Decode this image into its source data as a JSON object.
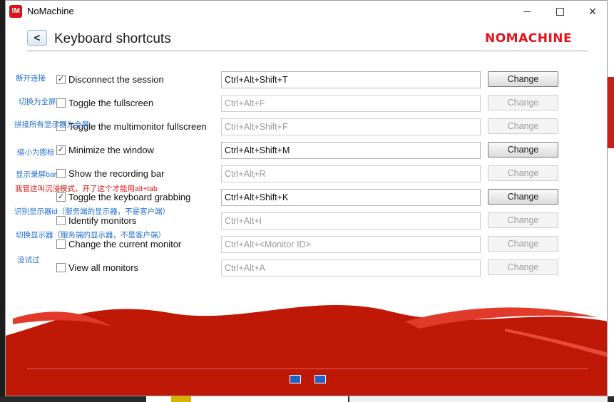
{
  "window": {
    "title": "NoMachine",
    "brand": "NOMACHINE"
  },
  "page": {
    "title": "Keyboard shortcuts",
    "back_label": "<"
  },
  "icons": {
    "app": "nomachine-logo-icon",
    "minimize": "minimize-icon",
    "maximize": "maximize-icon",
    "close": "close-icon",
    "back": "chevron-left-icon",
    "fullscreen": "fullscreen-icon",
    "windowed": "windowed-icon"
  },
  "colors": {
    "brand_red": "#e5141c",
    "footer_red": "#c01806",
    "note_blue": "#1f6fd1",
    "note_red": "#e11515"
  },
  "shortcuts": [
    {
      "label": "Disconnect the session",
      "value": "Ctrl+Alt+Shift+T",
      "checked": true,
      "enabled": true,
      "button": "Change"
    },
    {
      "label": "Toggle the fullscreen",
      "value": "Ctrl+Alt+F",
      "checked": false,
      "enabled": false,
      "button": "Change"
    },
    {
      "label": "Toggle the multimonitor fullscreen",
      "value": "Ctrl+Alt+Shift+F",
      "checked": false,
      "enabled": false,
      "button": "Change"
    },
    {
      "label": "Minimize the window",
      "value": "Ctrl+Alt+Shift+M",
      "checked": true,
      "enabled": true,
      "button": "Change"
    },
    {
      "label": "Show the recording bar",
      "value": "Ctrl+Alt+R",
      "checked": false,
      "enabled": false,
      "button": "Change"
    },
    {
      "label": "Toggle the keyboard grabbing",
      "value": "Ctrl+Alt+Shift+K",
      "checked": true,
      "enabled": true,
      "button": "Change"
    },
    {
      "label": "Identify monitors",
      "value": "Ctrl+Alt+I",
      "checked": false,
      "enabled": false,
      "button": "Change"
    },
    {
      "label": "Change the current monitor",
      "value": "Ctrl+Alt+<Monitor ID>",
      "checked": false,
      "enabled": false,
      "button": "Change"
    },
    {
      "label": "View all monitors",
      "value": "Ctrl+Alt+A",
      "checked": false,
      "enabled": false,
      "button": "Change"
    }
  ],
  "notes": [
    {
      "text": "断开连接",
      "color": "blue"
    },
    {
      "text": "切换为全屏",
      "color": "blue"
    },
    {
      "text": "拼接所有显示器为全屏",
      "color": "blue"
    },
    {
      "text": "缩小为图标",
      "color": "blue"
    },
    {
      "text": "显示录屏bar",
      "color": "blue"
    },
    {
      "text": "我管这叫沉浸模式，开了这个才能用alt+tab",
      "color": "red"
    },
    {
      "text": "识别显示器id（服务端的显示器，不是客户端）",
      "color": "blue"
    },
    {
      "text": "切换显示器（服务端的显示器，不是客户端）",
      "color": "blue"
    },
    {
      "text": "没试过",
      "color": "blue"
    }
  ]
}
